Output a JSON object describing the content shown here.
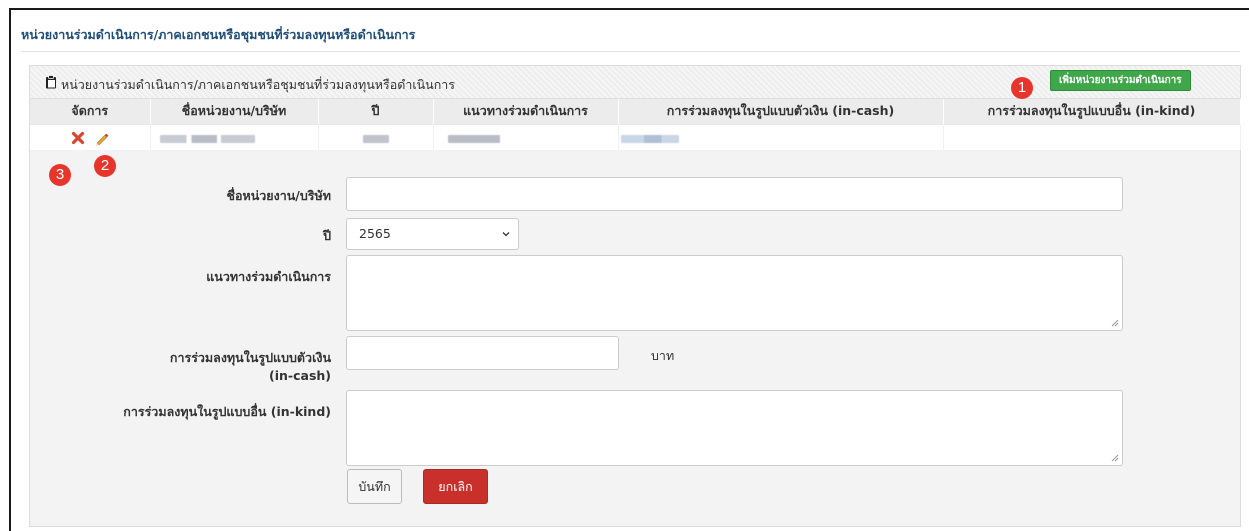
{
  "section": {
    "title": "หน่วยงานร่วมดำเนินการ/ภาคเอกชนหรือชุมชนที่ร่วมลงทุนหรือดำเนินการ"
  },
  "panel": {
    "title": "หน่วยงานร่วมดำเนินการ/ภาคเอกชนหรือชุมชนที่ร่วมลงทุนหรือดำเนินการ",
    "icon": "clipboard-icon",
    "add_button_label": "เพิ่มหน่วยงานร่วมดำเนินการ"
  },
  "markers": [
    "1",
    "2",
    "3"
  ],
  "table": {
    "columns": [
      "จัดการ",
      "ชื่อหน่วยงาน/บริษัท",
      "ปี",
      "แนวทางร่วมดำเนินการ",
      "การร่วมลงทุนในรูปแบบตัวเงิน (in-cash)",
      "การร่วมลงทุนในรูปแบบอื่น (in-kind)"
    ],
    "row_actions": [
      "delete-icon",
      "edit-icon"
    ]
  },
  "form": {
    "company_label": "ชื่อหน่วยงาน/บริษัท",
    "company_value": "",
    "year_label": "ปี",
    "year_value": "2565",
    "approach_label": "แนวทางร่วมดำเนินการ",
    "approach_value": "",
    "incash_label_line1": "การร่วมลงทุนในรูปแบบตัวเงิน",
    "incash_label_line2": "(in-cash)",
    "incash_value": "",
    "incash_unit": "บาท",
    "inkind_label": "การร่วมลงทุนในรูปแบบอื่น (in-kind)",
    "inkind_value": "",
    "save_label": "บันทึก",
    "cancel_label": "ยกเลิก"
  },
  "colors": {
    "accent_title": "#1f4e79",
    "add_button": "#3fa64a",
    "cancel_button": "#c9302c",
    "marker": "#e8352c"
  }
}
